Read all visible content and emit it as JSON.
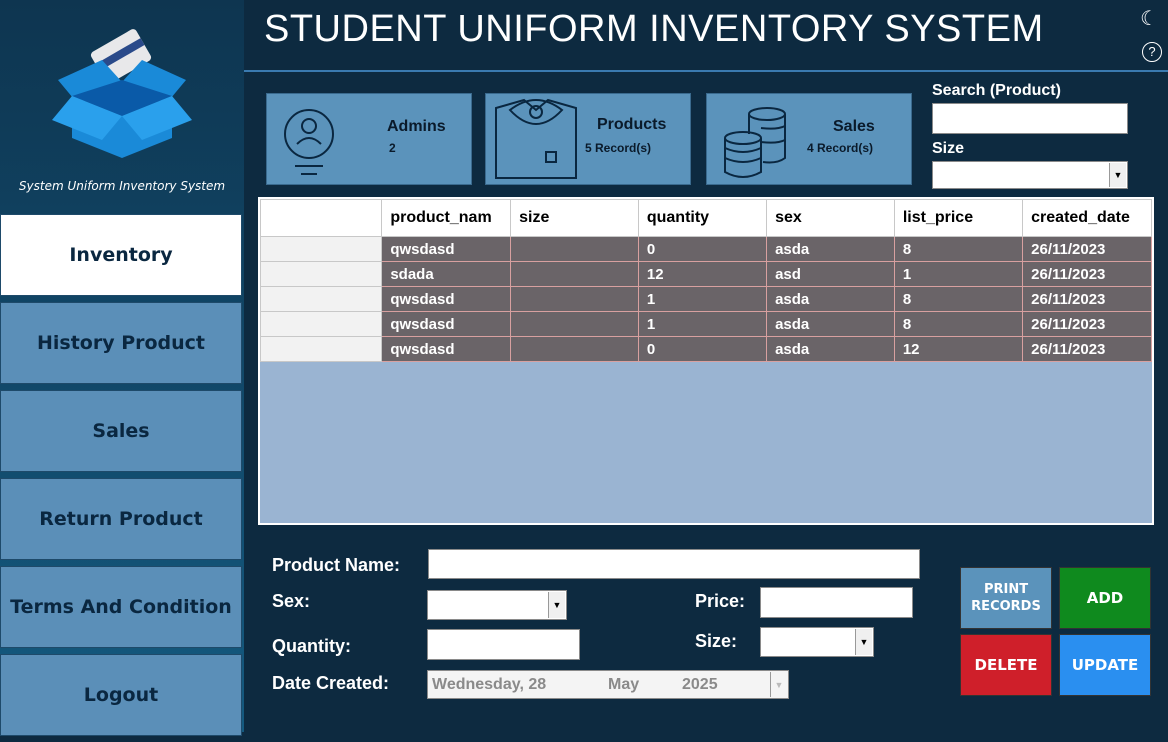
{
  "app": {
    "title": "STUDENT UNIFORM INVENTORY SYSTEM",
    "logo_caption": "System Uniform Inventory System"
  },
  "sidebar": {
    "items": [
      {
        "label": "Inventory",
        "active": true
      },
      {
        "label": "History Product"
      },
      {
        "label": "Sales"
      },
      {
        "label": "Return Product"
      },
      {
        "label": "Terms And Condition"
      },
      {
        "label": "Logout"
      }
    ]
  },
  "header": {
    "theme_icon": "moon-icon",
    "help_label": "?"
  },
  "cards": {
    "admins": {
      "label": "Admins",
      "value": "2",
      "icon": "user-icon"
    },
    "products": {
      "label": "Products",
      "value": "5 Record(s)",
      "icon": "shirt-icon"
    },
    "sales": {
      "label": "Sales",
      "value": "4 Record(s)",
      "icon": "coins-icon"
    }
  },
  "search": {
    "product_label": "Search (Product)",
    "product_value": "",
    "size_label": "Size",
    "size_value": ""
  },
  "table": {
    "columns": [
      "product_nam",
      "size",
      "quantity",
      "sex",
      "list_price",
      "created_date"
    ],
    "rows": [
      [
        "qwsdasd",
        "",
        "0",
        "asda",
        "8",
        "26/11/2023"
      ],
      [
        "sdada",
        "",
        "12",
        "asd",
        "1",
        "26/11/2023"
      ],
      [
        "qwsdasd",
        "",
        "1",
        "asda",
        "8",
        "26/11/2023"
      ],
      [
        "qwsdasd",
        "",
        "1",
        "asda",
        "8",
        "26/11/2023"
      ],
      [
        "qwsdasd",
        "",
        "0",
        "asda",
        "12",
        "26/11/2023"
      ]
    ]
  },
  "form": {
    "product_name_label": "Product Name:",
    "product_name_value": "",
    "sex_label": "Sex:",
    "sex_value": "",
    "price_label": "Price:",
    "price_value": "",
    "quantity_label": "Quantity:",
    "quantity_value": "",
    "size_label": "Size:",
    "size_value": "",
    "date_label": "Date Created:",
    "date_day": "Wednesday, 28",
    "date_month": "May",
    "date_year": "2025"
  },
  "buttons": {
    "print": "PRINT RECORDS",
    "add": "ADD",
    "delete": "DELETE",
    "update": "UPDATE"
  },
  "colors": {
    "print": "#5b93bb",
    "add": "#0f8a1e",
    "delete": "#cf1f2a",
    "update": "#2a8ff0"
  }
}
